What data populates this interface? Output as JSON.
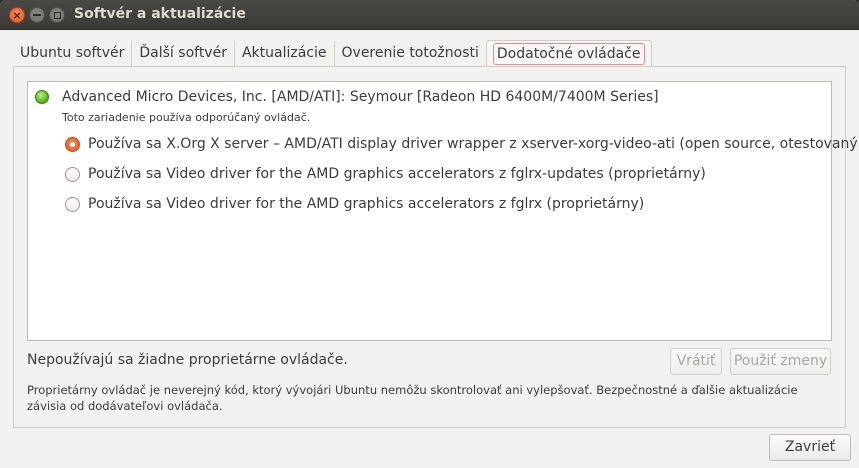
{
  "window": {
    "title": "Softvér a aktualizácie"
  },
  "tabs": [
    {
      "label": "Ubuntu softvér"
    },
    {
      "label": "Ďalší softvér"
    },
    {
      "label": "Aktualizácie"
    },
    {
      "label": "Overenie totožnosti"
    },
    {
      "label": "Dodatočné ovládače",
      "active": true
    }
  ],
  "device": {
    "name": "Advanced Micro Devices, Inc. [AMD/ATI]: Seymour [Radeon HD 6400M/7400M Series]",
    "note": "Toto zariadenie používa odporúčaný ovládač.",
    "status_color": "#5fb82a",
    "options": [
      {
        "label": "Používa sa X.Org X server – AMD/ATI display driver wrapper z xserver-xorg-video-ati (open source, otestovaný)",
        "selected": true
      },
      {
        "label": "Používa sa Video driver for the AMD graphics accelerators z fglrx-updates (proprietárny)",
        "selected": false
      },
      {
        "label": "Používa sa Video driver for the AMD graphics accelerators z fglrx (proprietárny)",
        "selected": false
      }
    ]
  },
  "status_text": "Nepoužívajú sa žiadne proprietárne ovládače.",
  "buttons": {
    "revert": "Vrátiť",
    "apply": "Použiť zmeny",
    "close": "Zavrieť"
  },
  "info_text": "Proprietárny ovládač je neverejný kód, ktorý vývojári Ubuntu nemôžu skontrolovať ani vylepšovať. Bezpečnostné a ďalšie aktualizácie závisia od dodávateľovi ovládača.",
  "colors": {
    "accent": "#e2531d",
    "titlebar": "#3b3a36"
  }
}
